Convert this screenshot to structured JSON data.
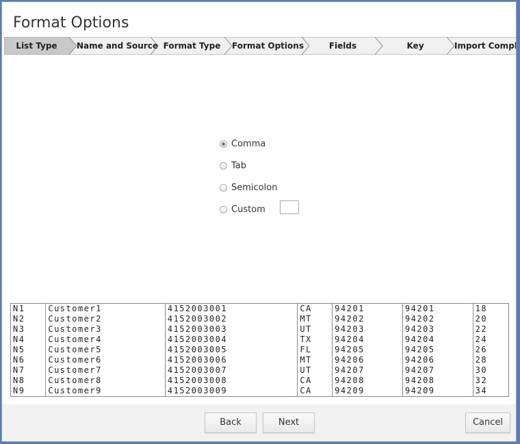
{
  "window": {
    "title": "Format Options"
  },
  "wizard": {
    "steps": [
      "List Type",
      "Name and Source",
      "Format Type",
      "Format Options",
      "Fields",
      "Key",
      "Import Complete"
    ],
    "active_index": 0
  },
  "delimiters": {
    "options": [
      "Comma",
      "Tab",
      "Semicolon",
      "Custom"
    ],
    "selected": "Comma",
    "custom_value": ""
  },
  "preview": {
    "rows": [
      [
        "N1",
        "Customer1",
        "4152003001",
        "CA",
        "94201",
        "94201",
        "18"
      ],
      [
        "N2",
        "Customer2",
        "4152003002",
        "MT",
        "94202",
        "94202",
        "20"
      ],
      [
        "N3",
        "Customer3",
        "4152003003",
        "UT",
        "94203",
        "94203",
        "22"
      ],
      [
        "N4",
        "Customer4",
        "4152003004",
        "TX",
        "94204",
        "94204",
        "24"
      ],
      [
        "N5",
        "Customer5",
        "4152003005",
        "FL",
        "94205",
        "94205",
        "26"
      ],
      [
        "N6",
        "Customer6",
        "4152003006",
        "MT",
        "94206",
        "94206",
        "28"
      ],
      [
        "N7",
        "Customer7",
        "4152003007",
        "UT",
        "94207",
        "94207",
        "30"
      ],
      [
        "N8",
        "Customer8",
        "4152003008",
        "CA",
        "94208",
        "94208",
        "32"
      ],
      [
        "N9",
        "Customer9",
        "4152003009",
        "CA",
        "94209",
        "94209",
        "34"
      ]
    ]
  },
  "buttons": {
    "back": "Back",
    "next": "Next",
    "cancel": "Cancel"
  },
  "colors": {
    "wizard_active": "#c9c9c9",
    "wizard_inactive": "#f0f0f0",
    "footer_bg": "#f2f2f2",
    "frame": "#5b7cb0"
  }
}
